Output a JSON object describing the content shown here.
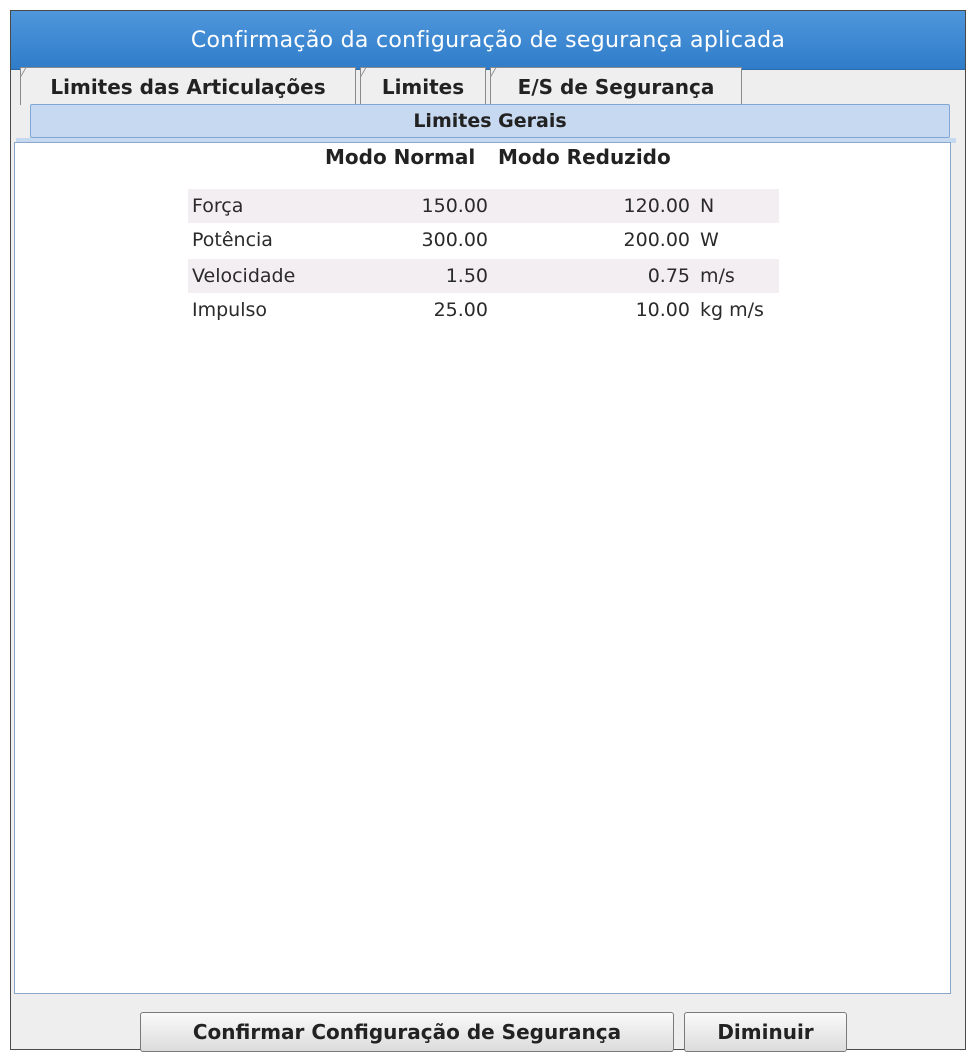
{
  "dialog": {
    "title": "Confirmação da configuração de segurança aplicada"
  },
  "tabs": [
    {
      "label": "Limites das Articulações"
    },
    {
      "label": "Limites"
    },
    {
      "label": "E/S de Segurança"
    }
  ],
  "subtab": {
    "label": "Limites Gerais"
  },
  "table": {
    "headers": {
      "normal": "Modo Normal",
      "reduced": "Modo Reduzido"
    },
    "rows": [
      {
        "name": "Força",
        "normal": "150.00",
        "reduced": "120.00",
        "unit": "N"
      },
      {
        "name": "Potência",
        "normal": "300.00",
        "reduced": "200.00",
        "unit": "W"
      },
      {
        "name": "Velocidade",
        "normal": "1.50",
        "reduced": "0.75",
        "unit": "m/s"
      },
      {
        "name": "Impulso",
        "normal": "25.00",
        "reduced": "10.00",
        "unit": "kg m/s"
      }
    ]
  },
  "buttons": {
    "confirm": "Confirmar Configuração de Segurança",
    "decrease": "Diminuir"
  }
}
